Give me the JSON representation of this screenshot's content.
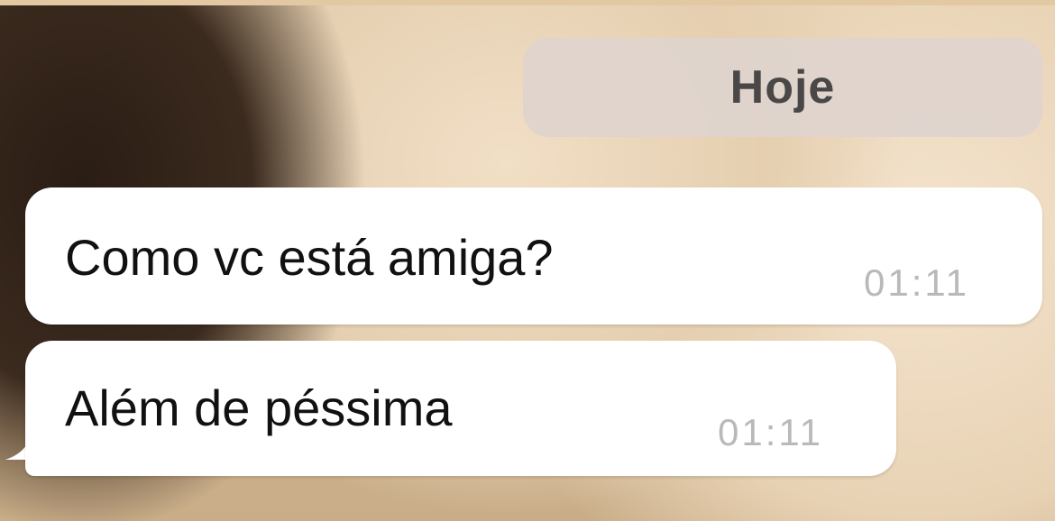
{
  "chat": {
    "date_separator": "Hoje",
    "messages": [
      {
        "text": "Como vc está amiga?",
        "time": "01:11"
      },
      {
        "text": "Além de péssima",
        "time": "01:11"
      }
    ]
  }
}
